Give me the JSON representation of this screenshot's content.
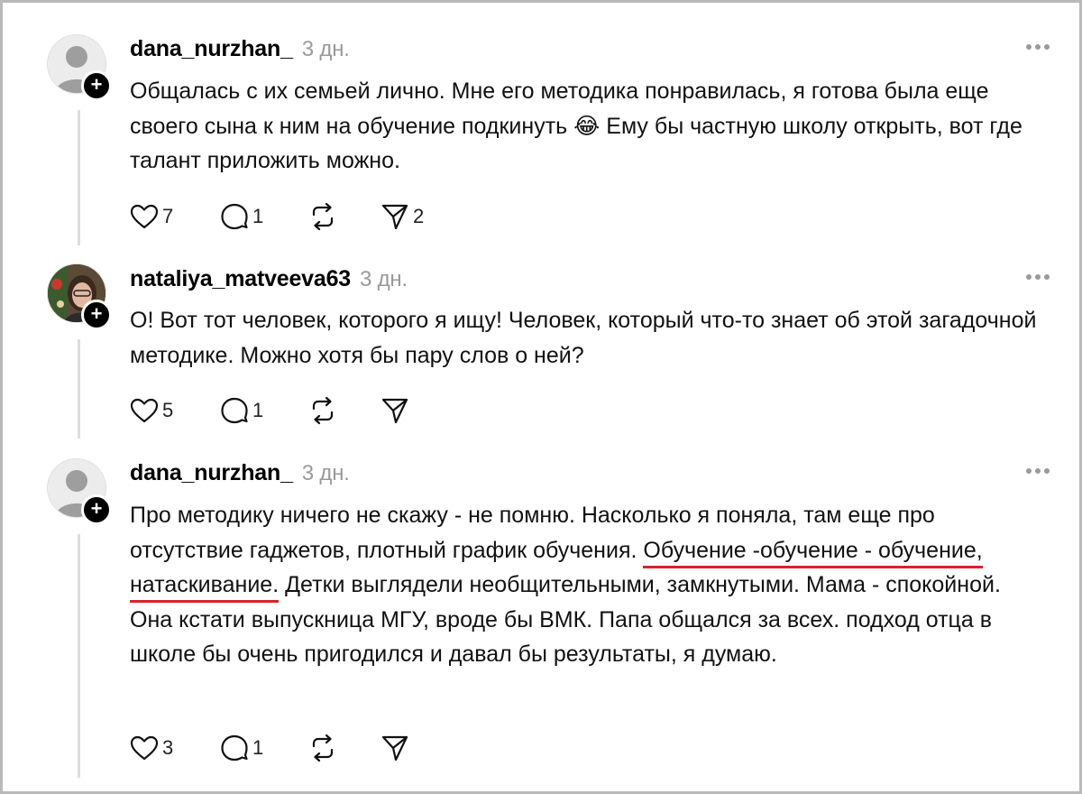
{
  "comments": [
    {
      "username": "dana_nurzhan_",
      "time": "3 дн.",
      "avatar": "default-avatar",
      "text_plain": "Общалась с их семьей лично. Мне его методика понравилась, я готова была еще своего сына к ним на обучение подкинуть 😂 Ему бы частную школу открыть, вот где талант приложить можно.",
      "likes": "7",
      "replies": "1",
      "shares": "2"
    },
    {
      "username": "nataliya_matveeva63",
      "time": "3 дн.",
      "avatar": "photo-avatar",
      "text_plain": "О! Вот тот человек, которого я ищу! Человек, который что-то знает об этой загадочной методике. Можно хотя бы пару слов о ней?",
      "likes": "5",
      "replies": "1",
      "shares": ""
    },
    {
      "username": "dana_nurzhan_",
      "time": "3 дн.",
      "avatar": "default-avatar",
      "text_before": "Про методику ничего не скажу - не помню. Насколько я поняла, там еще про отсутствие гаджетов, плотный график обучения. ",
      "text_highlight": "Обучение -обучение - обучение, натаскивание.",
      "text_after": " Детки выглядели необщительными, замкнутыми. Мама - спокойной. Она кстати выпускница МГУ, вроде бы ВМК. Папа общался за всех. подход отца в школе бы очень пригодился и давал бы результаты, я думаю.",
      "likes": "3",
      "replies": "1",
      "shares": ""
    }
  ],
  "colors": {
    "highlight_underline": "#d9222a",
    "timestamp": "#999999",
    "thread_line": "#dddddd"
  },
  "icons": [
    "heart-icon",
    "comment-icon",
    "repost-icon",
    "share-icon",
    "more-icon",
    "follow-plus-icon"
  ]
}
